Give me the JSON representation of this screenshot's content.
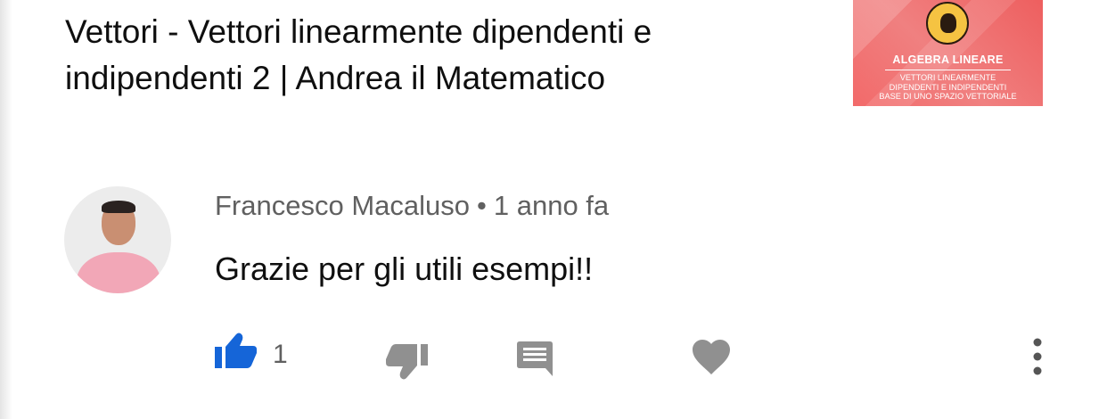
{
  "video": {
    "title": "Vettori - Vettori linearmente dipendenti e indipendenti 2 | Andrea il Matematico",
    "thumbnail": {
      "title": "ALGEBRA LINEARE",
      "subtitle_lines": [
        "VETTORI LINEARMENTE",
        "DIPENDENTI E INDIPENDENTI",
        "BASE DI UNO SPAZIO VETTORIALE"
      ]
    }
  },
  "comment": {
    "author": "Francesco Macaluso",
    "separator": "•",
    "time": "1 anno fa",
    "text": "Grazie per gli utili esempi!!",
    "like_count": "1"
  },
  "actions": {
    "like_icon": "thumb-up-icon",
    "dislike_icon": "thumb-down-icon",
    "reply_icon": "comment-icon",
    "heart_icon": "heart-icon",
    "more_icon": "more-vert-icon"
  },
  "colors": {
    "like_active": "#1565d8",
    "icon_gray": "#909090",
    "secondary_text": "#606060",
    "thumbnail_bg": "#f07070"
  }
}
